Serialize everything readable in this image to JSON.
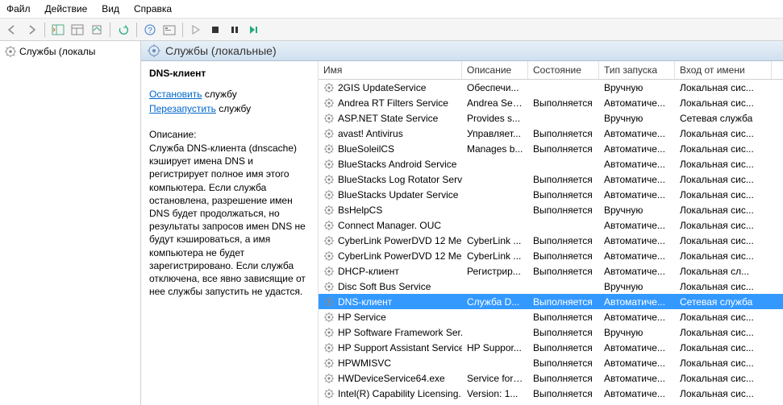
{
  "menu": {
    "file": "Файл",
    "action": "Действие",
    "view": "Вид",
    "help": "Справка"
  },
  "tree": {
    "root": "Службы (локалы"
  },
  "header": {
    "title": "Службы (локальные)"
  },
  "detail": {
    "title": "DNS-клиент",
    "stop_link": "Остановить",
    "stop_suffix": " службу",
    "restart_link": "Перезапустить",
    "restart_suffix": " службу",
    "desc_label": "Описание:",
    "desc": "Служба DNS-клиента (dnscache) кэширует имена DNS и регистрирует полное имя этого компьютера. Если служба остановлена, разрешение имен DNS будет продолжаться, но результаты запросов имен DNS не будут кэшироваться, а имя компьютера не будет зарегистрировано. Если служба отключена, все явно зависящие от нее службы запустить не удастся."
  },
  "columns": {
    "name": "Имя",
    "desc": "Описание",
    "state": "Состояние",
    "start": "Тип запуска",
    "logon": "Вход от имени"
  },
  "services": [
    {
      "name": "2GIS UpdateService",
      "desc": "Обеспечи...",
      "state": "",
      "start": "Вручную",
      "logon": "Локальная сис..."
    },
    {
      "name": "Andrea RT Filters Service",
      "desc": "Andrea Ser...",
      "state": "Выполняется",
      "start": "Автоматиче...",
      "logon": "Локальная сис..."
    },
    {
      "name": "ASP.NET State Service",
      "desc": "Provides s...",
      "state": "",
      "start": "Вручную",
      "logon": "Сетевая служба"
    },
    {
      "name": "avast! Antivirus",
      "desc": "Управляет...",
      "state": "Выполняется",
      "start": "Автоматиче...",
      "logon": "Локальная сис..."
    },
    {
      "name": "BlueSoleilCS",
      "desc": "Manages b...",
      "state": "Выполняется",
      "start": "Автоматиче...",
      "logon": "Локальная сис..."
    },
    {
      "name": "BlueStacks Android Service",
      "desc": "",
      "state": "",
      "start": "Автоматиче...",
      "logon": "Локальная сис..."
    },
    {
      "name": "BlueStacks Log Rotator Serv...",
      "desc": "",
      "state": "Выполняется",
      "start": "Автоматиче...",
      "logon": "Локальная сис..."
    },
    {
      "name": "BlueStacks Updater Service",
      "desc": "",
      "state": "Выполняется",
      "start": "Автоматиче...",
      "logon": "Локальная сис..."
    },
    {
      "name": "BsHelpCS",
      "desc": "",
      "state": "Выполняется",
      "start": "Вручную",
      "logon": "Локальная сис..."
    },
    {
      "name": "Connect Manager. OUC",
      "desc": "",
      "state": "",
      "start": "Автоматиче...",
      "logon": "Локальная сис..."
    },
    {
      "name": "CyberLink PowerDVD 12 Me...",
      "desc": "CyberLink ...",
      "state": "Выполняется",
      "start": "Автоматиче...",
      "logon": "Локальная сис..."
    },
    {
      "name": "CyberLink PowerDVD 12 Me...",
      "desc": "CyberLink ...",
      "state": "Выполняется",
      "start": "Автоматиче...",
      "logon": "Локальная сис..."
    },
    {
      "name": "DHCP-клиент",
      "desc": "Регистрир...",
      "state": "Выполняется",
      "start": "Автоматиче...",
      "logon": "Локальная сл..."
    },
    {
      "name": "Disc Soft Bus Service",
      "desc": "",
      "state": "",
      "start": "Вручную",
      "logon": "Локальная сис..."
    },
    {
      "name": "DNS-клиент",
      "desc": "Служба D...",
      "state": "Выполняется",
      "start": "Автоматиче...",
      "logon": "Сетевая служба",
      "selected": true
    },
    {
      "name": "HP Service",
      "desc": "",
      "state": "Выполняется",
      "start": "Автоматиче...",
      "logon": "Локальная сис..."
    },
    {
      "name": "HP Software Framework Ser...",
      "desc": "",
      "state": "Выполняется",
      "start": "Вручную",
      "logon": "Локальная сис..."
    },
    {
      "name": "HP Support Assistant Service",
      "desc": "HP Suppor...",
      "state": "Выполняется",
      "start": "Автоматиче...",
      "logon": "Локальная сис..."
    },
    {
      "name": "HPWMISVC",
      "desc": "",
      "state": "Выполняется",
      "start": "Автоматиче...",
      "logon": "Локальная сис..."
    },
    {
      "name": "HWDeviceService64.exe",
      "desc": "Service for ...",
      "state": "Выполняется",
      "start": "Автоматиче...",
      "logon": "Локальная сис..."
    },
    {
      "name": "Intel(R) Capability Licensing...",
      "desc": "Version: 1...",
      "state": "Выполняется",
      "start": "Автоматиче...",
      "logon": "Локальная сис..."
    }
  ]
}
